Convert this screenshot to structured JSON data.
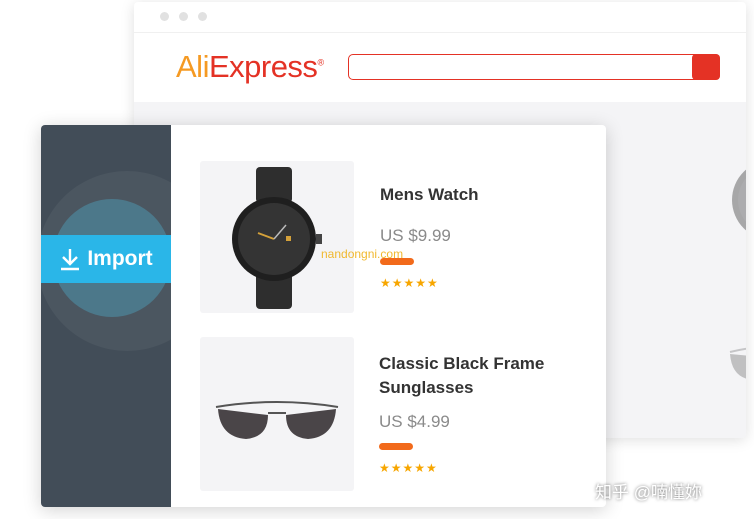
{
  "browser": {
    "logo_ali": "Ali",
    "logo_express": "Express",
    "logo_mark": "®",
    "search_value": ""
  },
  "plugin": {
    "import_label": "Import"
  },
  "products": [
    {
      "title": "Mens Watch",
      "price": "US $9.99",
      "rating_stars": "★★★★★"
    },
    {
      "title_line1": "Classic Black Frame",
      "title_line2": "Sunglasses",
      "price": "US $4.99",
      "rating_stars": "★★★★★"
    }
  ],
  "overlay": {
    "watermark": "nandongni.com",
    "credit": "知乎 @喃懂妳"
  },
  "colors": {
    "brand_orange": "#f59a23",
    "brand_red": "#e43225",
    "import_blue": "#2ab6e8",
    "sidebar": "#424d58",
    "price_bar": "#f26a1b",
    "star": "#f7a600"
  }
}
